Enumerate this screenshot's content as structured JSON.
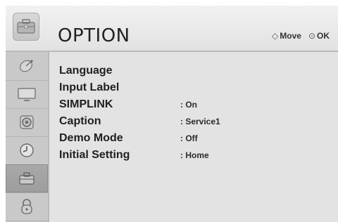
{
  "header": {
    "title": "OPTION",
    "icon": "option-toolbox-icon",
    "hints": {
      "move_symbol": "◇",
      "move_label": "Move",
      "ok_symbol": "⊙",
      "ok_label": "OK"
    }
  },
  "sidebar": {
    "items": [
      {
        "name": "satellite-dish-icon",
        "active": false
      },
      {
        "name": "tv-screen-icon",
        "active": false
      },
      {
        "name": "speaker-icon",
        "active": false
      },
      {
        "name": "clock-icon",
        "active": false
      },
      {
        "name": "toolbox-icon",
        "active": true
      },
      {
        "name": "lock-icon",
        "active": false
      }
    ]
  },
  "menu": {
    "items": [
      {
        "label": "Language",
        "value": ""
      },
      {
        "label": "Input Label",
        "value": ""
      },
      {
        "label": "SIMPLINK",
        "value": ": On"
      },
      {
        "label": "Caption",
        "value": ": Service1"
      },
      {
        "label": "Demo Mode",
        "value": ": Off"
      },
      {
        "label": "Initial Setting",
        "value": ": Home"
      }
    ]
  }
}
